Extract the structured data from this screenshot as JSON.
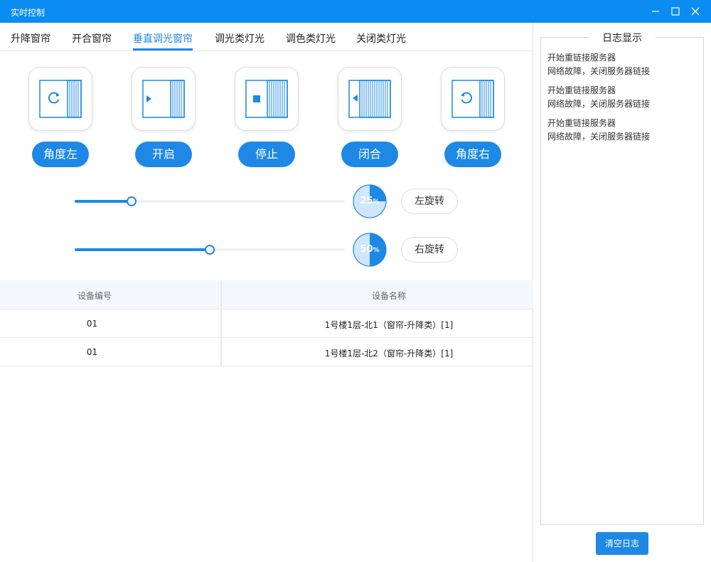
{
  "window": {
    "title": "实时控制"
  },
  "tabs": [
    {
      "label": "升降窗帘"
    },
    {
      "label": "开合窗帘"
    },
    {
      "label": "垂直调光窗帘"
    },
    {
      "label": "调光类灯光"
    },
    {
      "label": "调色类灯光"
    },
    {
      "label": "关闭类灯光"
    }
  ],
  "active_tab": "垂直调光窗帘",
  "controls": [
    {
      "label": "角度左",
      "icon": "rotate-cw-blind-icon"
    },
    {
      "label": "开启",
      "icon": "play-blind-icon"
    },
    {
      "label": "停止",
      "icon": "stop-blind-icon"
    },
    {
      "label": "闭合",
      "icon": "close-blind-icon"
    },
    {
      "label": "角度右",
      "icon": "rotate-ccw-blind-icon"
    }
  ],
  "sliders": [
    {
      "value": 0.21,
      "percent_num": "25",
      "percent_sign": "%",
      "button": "左旋转"
    },
    {
      "value": 0.5,
      "percent_num": "50",
      "percent_sign": "%",
      "button": "右旋转"
    }
  ],
  "table": {
    "headers": [
      "设备编号",
      "设备名称"
    ],
    "rows": [
      [
        "01",
        "1号楼1层-北1（窗帘-升降类）[1]"
      ],
      [
        "01",
        "1号楼1层-北2（窗帘-升降类）[1]"
      ]
    ]
  },
  "log": {
    "title": "日志显示",
    "lines": [
      "开始重链接服务器",
      "网络故障，关闭服务器链接",
      "开始重链接服务器",
      "网络故障，关闭服务器链接",
      "开始重链接服务器",
      "网络故障，关闭服务器链接"
    ],
    "clear_button": "清空日志"
  },
  "colors": {
    "titlebar": "#0a8cf0",
    "accent": "#1e88e5",
    "pie_light": "#cfe6fb"
  }
}
